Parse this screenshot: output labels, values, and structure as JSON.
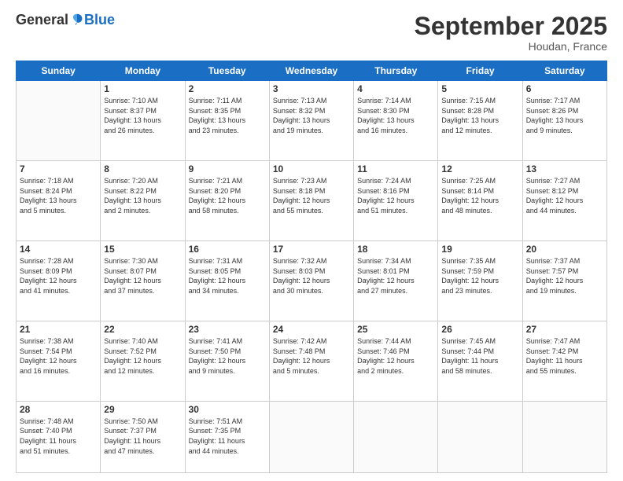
{
  "logo": {
    "general": "General",
    "blue": "Blue"
  },
  "header": {
    "title": "September 2025",
    "subtitle": "Houdan, France"
  },
  "weekdays": [
    "Sunday",
    "Monday",
    "Tuesday",
    "Wednesday",
    "Thursday",
    "Friday",
    "Saturday"
  ],
  "weeks": [
    [
      {
        "day": "",
        "info": ""
      },
      {
        "day": "1",
        "info": "Sunrise: 7:10 AM\nSunset: 8:37 PM\nDaylight: 13 hours\nand 26 minutes."
      },
      {
        "day": "2",
        "info": "Sunrise: 7:11 AM\nSunset: 8:35 PM\nDaylight: 13 hours\nand 23 minutes."
      },
      {
        "day": "3",
        "info": "Sunrise: 7:13 AM\nSunset: 8:32 PM\nDaylight: 13 hours\nand 19 minutes."
      },
      {
        "day": "4",
        "info": "Sunrise: 7:14 AM\nSunset: 8:30 PM\nDaylight: 13 hours\nand 16 minutes."
      },
      {
        "day": "5",
        "info": "Sunrise: 7:15 AM\nSunset: 8:28 PM\nDaylight: 13 hours\nand 12 minutes."
      },
      {
        "day": "6",
        "info": "Sunrise: 7:17 AM\nSunset: 8:26 PM\nDaylight: 13 hours\nand 9 minutes."
      }
    ],
    [
      {
        "day": "7",
        "info": "Sunrise: 7:18 AM\nSunset: 8:24 PM\nDaylight: 13 hours\nand 5 minutes."
      },
      {
        "day": "8",
        "info": "Sunrise: 7:20 AM\nSunset: 8:22 PM\nDaylight: 13 hours\nand 2 minutes."
      },
      {
        "day": "9",
        "info": "Sunrise: 7:21 AM\nSunset: 8:20 PM\nDaylight: 12 hours\nand 58 minutes."
      },
      {
        "day": "10",
        "info": "Sunrise: 7:23 AM\nSunset: 8:18 PM\nDaylight: 12 hours\nand 55 minutes."
      },
      {
        "day": "11",
        "info": "Sunrise: 7:24 AM\nSunset: 8:16 PM\nDaylight: 12 hours\nand 51 minutes."
      },
      {
        "day": "12",
        "info": "Sunrise: 7:25 AM\nSunset: 8:14 PM\nDaylight: 12 hours\nand 48 minutes."
      },
      {
        "day": "13",
        "info": "Sunrise: 7:27 AM\nSunset: 8:12 PM\nDaylight: 12 hours\nand 44 minutes."
      }
    ],
    [
      {
        "day": "14",
        "info": "Sunrise: 7:28 AM\nSunset: 8:09 PM\nDaylight: 12 hours\nand 41 minutes."
      },
      {
        "day": "15",
        "info": "Sunrise: 7:30 AM\nSunset: 8:07 PM\nDaylight: 12 hours\nand 37 minutes."
      },
      {
        "day": "16",
        "info": "Sunrise: 7:31 AM\nSunset: 8:05 PM\nDaylight: 12 hours\nand 34 minutes."
      },
      {
        "day": "17",
        "info": "Sunrise: 7:32 AM\nSunset: 8:03 PM\nDaylight: 12 hours\nand 30 minutes."
      },
      {
        "day": "18",
        "info": "Sunrise: 7:34 AM\nSunset: 8:01 PM\nDaylight: 12 hours\nand 27 minutes."
      },
      {
        "day": "19",
        "info": "Sunrise: 7:35 AM\nSunset: 7:59 PM\nDaylight: 12 hours\nand 23 minutes."
      },
      {
        "day": "20",
        "info": "Sunrise: 7:37 AM\nSunset: 7:57 PM\nDaylight: 12 hours\nand 19 minutes."
      }
    ],
    [
      {
        "day": "21",
        "info": "Sunrise: 7:38 AM\nSunset: 7:54 PM\nDaylight: 12 hours\nand 16 minutes."
      },
      {
        "day": "22",
        "info": "Sunrise: 7:40 AM\nSunset: 7:52 PM\nDaylight: 12 hours\nand 12 minutes."
      },
      {
        "day": "23",
        "info": "Sunrise: 7:41 AM\nSunset: 7:50 PM\nDaylight: 12 hours\nand 9 minutes."
      },
      {
        "day": "24",
        "info": "Sunrise: 7:42 AM\nSunset: 7:48 PM\nDaylight: 12 hours\nand 5 minutes."
      },
      {
        "day": "25",
        "info": "Sunrise: 7:44 AM\nSunset: 7:46 PM\nDaylight: 12 hours\nand 2 minutes."
      },
      {
        "day": "26",
        "info": "Sunrise: 7:45 AM\nSunset: 7:44 PM\nDaylight: 11 hours\nand 58 minutes."
      },
      {
        "day": "27",
        "info": "Sunrise: 7:47 AM\nSunset: 7:42 PM\nDaylight: 11 hours\nand 55 minutes."
      }
    ],
    [
      {
        "day": "28",
        "info": "Sunrise: 7:48 AM\nSunset: 7:40 PM\nDaylight: 11 hours\nand 51 minutes."
      },
      {
        "day": "29",
        "info": "Sunrise: 7:50 AM\nSunset: 7:37 PM\nDaylight: 11 hours\nand 47 minutes."
      },
      {
        "day": "30",
        "info": "Sunrise: 7:51 AM\nSunset: 7:35 PM\nDaylight: 11 hours\nand 44 minutes."
      },
      {
        "day": "",
        "info": ""
      },
      {
        "day": "",
        "info": ""
      },
      {
        "day": "",
        "info": ""
      },
      {
        "day": "",
        "info": ""
      }
    ]
  ]
}
